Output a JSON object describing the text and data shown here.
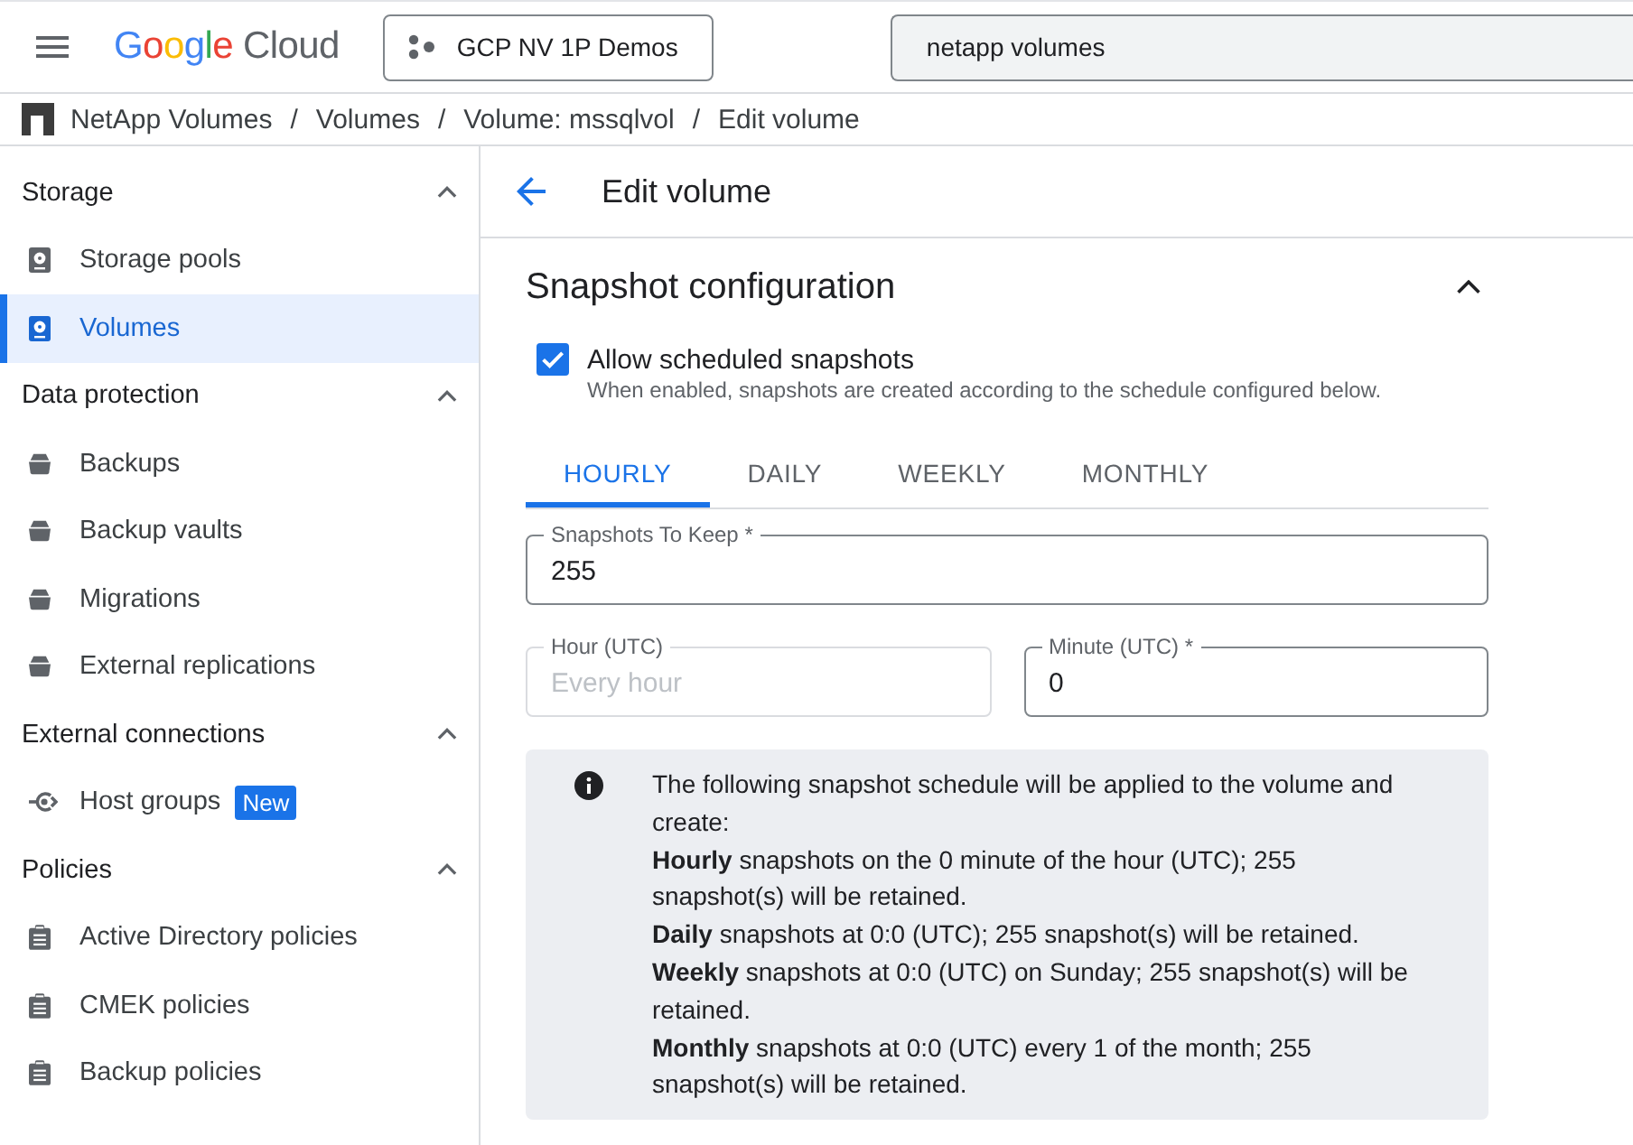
{
  "top_bar": {
    "logo": {
      "brand": "Google",
      "product": "Cloud"
    },
    "project_button": "GCP NV 1P Demos",
    "search": {
      "value": "netapp volumes"
    }
  },
  "breadcrumb": [
    {
      "kind": "link",
      "label": "NetApp Volumes"
    },
    {
      "kind": "separator",
      "label": "/"
    },
    {
      "kind": "link",
      "label": "Volumes"
    },
    {
      "kind": "separator",
      "label": "/"
    },
    {
      "kind": "link",
      "label": "Volume: mssqlvol"
    },
    {
      "kind": "separator",
      "label": "/"
    },
    {
      "kind": "link",
      "label": "Edit volume"
    }
  ],
  "sidebar": {
    "sections": [
      {
        "title": "Storage",
        "expanded": true,
        "items": [
          {
            "label": "Storage pools",
            "selected": false
          },
          {
            "label": "Volumes",
            "selected": true
          }
        ]
      },
      {
        "title": "Data protection",
        "expanded": true,
        "items": [
          {
            "label": "Backups",
            "selected": false
          },
          {
            "label": "Backup vaults",
            "selected": false
          },
          {
            "label": "Migrations",
            "selected": false
          },
          {
            "label": "External replications",
            "selected": false
          }
        ]
      },
      {
        "title": "External connections",
        "expanded": true,
        "items": [
          {
            "label": "Host groups",
            "selected": false,
            "badge": "New"
          }
        ]
      },
      {
        "title": "Policies",
        "expanded": true,
        "items": [
          {
            "label": "Active Directory policies",
            "selected": false
          },
          {
            "label": "CMEK policies",
            "selected": false
          },
          {
            "label": "Backup policies",
            "selected": false
          }
        ]
      }
    ]
  },
  "page_header": {
    "title": "Edit volume"
  },
  "snapshot_section": {
    "title": "Snapshot configuration",
    "expanded": true,
    "allow_scheduled": {
      "label": "Allow scheduled snapshots",
      "description": "When enabled, snapshots are created according to the schedule configured below.",
      "checked": true
    },
    "tabs": [
      {
        "label": "HOURLY",
        "selected": true
      },
      {
        "label": "DAILY",
        "selected": false
      },
      {
        "label": "WEEKLY",
        "selected": false
      },
      {
        "label": "MONTHLY",
        "selected": false
      }
    ],
    "snapshots_to_keep": {
      "label": "Snapshots To Keep *",
      "value": "255",
      "disabled": false
    },
    "hour": {
      "label": "Hour (UTC)",
      "placeholder": "Every hour",
      "disabled": true
    },
    "minute": {
      "label": "Minute (UTC) *",
      "value": "0",
      "disabled": false
    },
    "info": {
      "lines": [
        "The following snapshot schedule will be applied to the volume and create:",
        "**Hourly** snapshots on the 0 minute of the hour (UTC); 255 snapshot(s) will be retained.",
        "**Daily** snapshots at 0:0 (UTC); 255 snapshot(s) will be retained.",
        "**Weekly** snapshots at 0:0 (UTC) on Sunday; 255 snapshot(s) will be retained.",
        "**Monthly** snapshots at 0:0 (UTC) every 1 of the month; 255 snapshot(s) will be retained."
      ]
    }
  }
}
